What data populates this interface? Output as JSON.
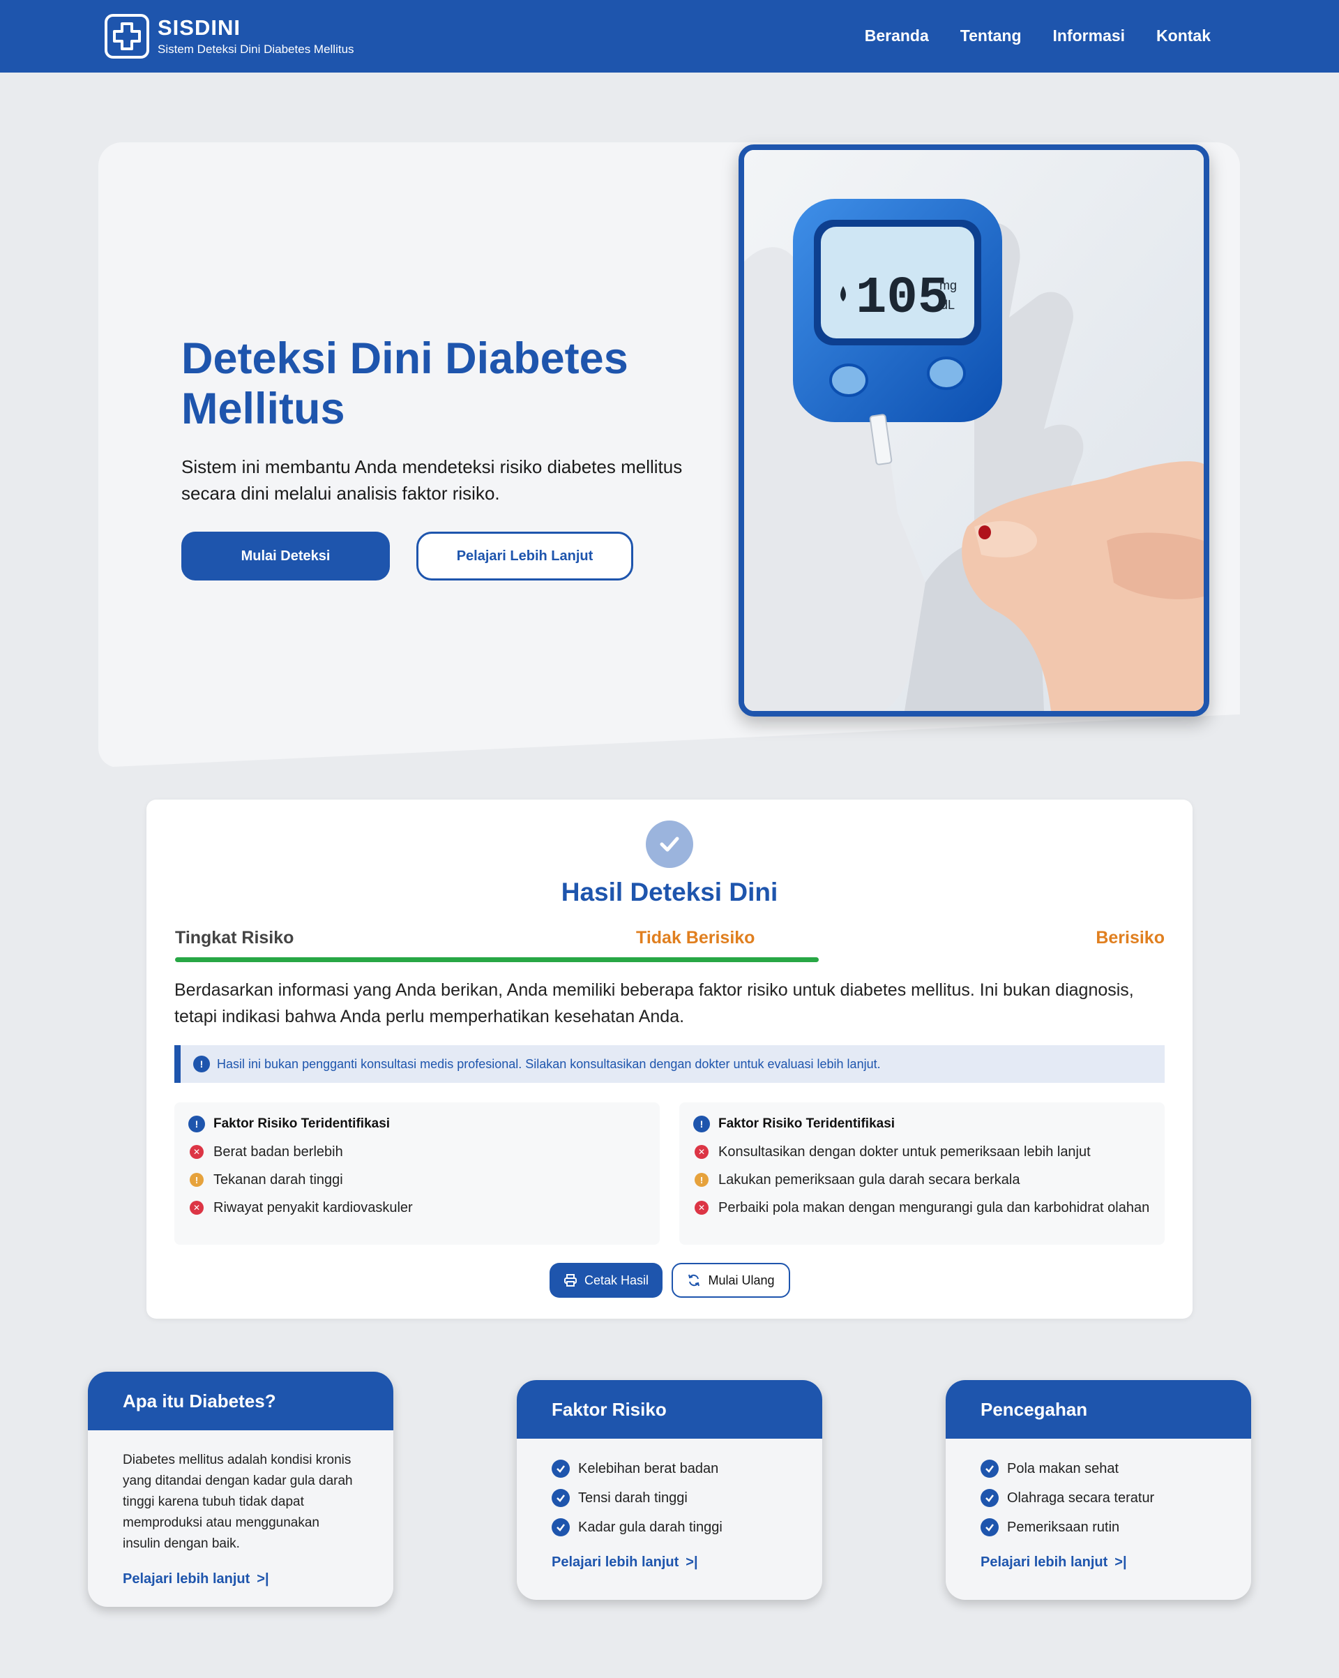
{
  "navbar": {
    "brand_name": "SISDINI",
    "brand_sub": "Sistem Deteksi Dini Diabetes Mellitus",
    "links": [
      "Beranda",
      "Tentang",
      "Informasi",
      "Kontak"
    ]
  },
  "hero": {
    "title": "Deteksi Dini Diabetes Mellitus",
    "description": "Sistem ini membantu Anda mendeteksi risiko diabetes mellitus secara dini melalui analisis faktor risiko.",
    "primary_button": "Mulai Deteksi",
    "secondary_button": "Pelajari Lebih Lanjut",
    "image_reading": "105",
    "image_unit_top": "mg",
    "image_unit_bottom": "dL"
  },
  "result": {
    "title": "Hasil Deteksi Dini",
    "risk_label": "Tingkat Risiko",
    "risk_safe": "Tidak Berisiko",
    "risk_danger": "Berisiko",
    "risk_level_fraction": 0.52,
    "description": "Berdasarkan informasi yang Anda berikan, Anda memiliki beberapa faktor risiko untuk diabetes mellitus. Ini bukan diagnosis, tetapi indikasi bahwa Anda perlu memperhatikan kesehatan Anda.",
    "alert": "Hasil ini bukan pengganti konsultasi medis profesional. Silakan konsultasikan dengan dokter untuk evaluasi lebih lanjut.",
    "left_box": {
      "heading": "Faktor Risiko Teridentifikasi",
      "items": [
        {
          "text": "Berat badan berlebih",
          "status": "x"
        },
        {
          "text": "Tekanan darah tinggi",
          "status": "warn"
        },
        {
          "text": "Riwayat penyakit kardiovaskuler",
          "status": "x"
        }
      ]
    },
    "right_box": {
      "heading": "Faktor Risiko Teridentifikasi",
      "items": [
        {
          "text": "Konsultasikan dengan dokter untuk pemeriksaan lebih lanjut",
          "status": "x"
        },
        {
          "text": "Lakukan pemeriksaan gula darah secara berkala",
          "status": "warn"
        },
        {
          "text": "Perbaiki pola makan dengan mengurangi gula dan karbohidrat olahan",
          "status": "x"
        }
      ]
    },
    "print_button": "Cetak Hasil",
    "restart_button": "Mulai Ulang"
  },
  "info_cards": [
    {
      "title": "Apa itu Diabetes?",
      "text": "Diabetes mellitus adalah kondisi kronis yang ditandai dengan kadar gula darah tinggi karena tubuh tidak dapat memproduksi atau menggunakan insulin dengan baik.",
      "link": "Pelajari lebih lanjut"
    },
    {
      "title": "Faktor Risiko",
      "items": [
        "Kelebihan berat badan",
        "Tensi darah tinggi",
        "Kadar gula darah tinggi"
      ],
      "link": "Pelajari lebih lanjut"
    },
    {
      "title": "Pencegahan",
      "items": [
        "Pola makan sehat",
        "Olahraga secara teratur",
        "Pemeriksaan rutin"
      ],
      "link": "Pelajari lebih lanjut"
    }
  ],
  "colors": {
    "primary": "#1e55ad",
    "safe_bar": "#28a745",
    "risk_text": "#e07f1f",
    "danger_icon": "#dc3545",
    "warning_icon": "#e6a23c"
  }
}
